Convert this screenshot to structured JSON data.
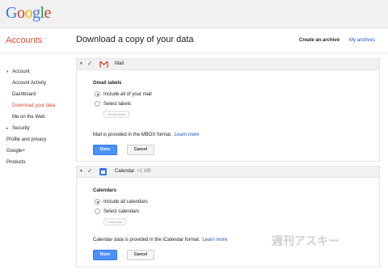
{
  "app": {
    "logo_letters": [
      {
        "ch": "G",
        "color": "#3b75e8"
      },
      {
        "ch": "o",
        "color": "#d93a2b"
      },
      {
        "ch": "o",
        "color": "#f4b400"
      },
      {
        "ch": "g",
        "color": "#3b75e8"
      },
      {
        "ch": "l",
        "color": "#1e9e4a"
      },
      {
        "ch": "e",
        "color": "#d93a2b"
      }
    ],
    "section_title": "Accounts",
    "page_title": "Download a copy of your data",
    "create_archive": "Create an archive",
    "my_archives": "My archives"
  },
  "sidebar": {
    "items": [
      {
        "label": "Account",
        "level": 0,
        "expander": "▾",
        "active": false
      },
      {
        "label": "Account Activity",
        "level": 1,
        "active": false
      },
      {
        "label": "Dashboard",
        "level": 1,
        "active": false
      },
      {
        "label": "Download your data",
        "level": 1,
        "active": true
      },
      {
        "label": "Me on the Web",
        "level": 1,
        "active": false
      },
      {
        "label": "Security",
        "level": 0,
        "expander": "▸",
        "active": false
      },
      {
        "label": "Profile and privacy",
        "level": 0,
        "active": false
      },
      {
        "label": "Google+",
        "level": 0,
        "active": false
      },
      {
        "label": "Products",
        "level": 0,
        "active": false
      }
    ]
  },
  "mail": {
    "service_name": "Mail",
    "icon": "gmail-icon",
    "group_title": "Gmail labels",
    "option_all": "Include all of your mail",
    "option_select": "Select labels",
    "mini_button": "Gmail labels",
    "info_text": "Mail is provided in the MBOX format.",
    "learn_more": "Learn more",
    "done": "Done",
    "cancel": "Cancel"
  },
  "calendar": {
    "service_name": "Calendar",
    "size": "<1 MB",
    "icon": "calendar-icon",
    "group_title": "Calendars",
    "option_all": "Include all calendars",
    "option_select": "Select calendars",
    "mini_button": "Calendars",
    "info_text": "Calendar data is provided in the iCalendar format.",
    "learn_more": "Learn more",
    "done": "Done",
    "cancel": "Cancel"
  },
  "watermark": "週刊アスキー",
  "colors": {
    "accent_red": "#dd4b39",
    "link_blue": "#1155cc",
    "button_blue": "#4d90fe"
  }
}
